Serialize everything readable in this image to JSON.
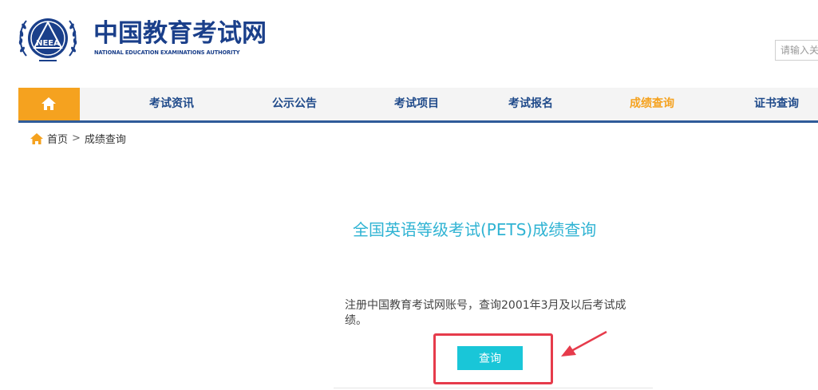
{
  "header": {
    "logo_title": "中国教育考试网",
    "logo_subtitle": "NATIONAL EDUCATION EXAMINATIONS AUTHORITY",
    "logo_emblem_text": "NEEA",
    "search_placeholder": "请输入关键字"
  },
  "nav": {
    "items": [
      {
        "label": "考试资讯"
      },
      {
        "label": "公示公告"
      },
      {
        "label": "考试项目"
      },
      {
        "label": "考试报名"
      },
      {
        "label": "成绩查询",
        "active": true
      },
      {
        "label": "证书查询"
      }
    ]
  },
  "breadcrumb": {
    "home": "首页",
    "separator": ">",
    "current": "成绩查询"
  },
  "main": {
    "title": "全国英语等级考试(PETS)成绩查询",
    "description": "注册中国教育考试网账号，查询2001年3月及以后考试成绩。",
    "query_button": "查询"
  },
  "colors": {
    "brand_blue": "#1a3f8a",
    "accent_orange": "#f5a21f",
    "title_cyan": "#2fb3d3",
    "button_cyan": "#19c6d8",
    "annotation_red": "#e63b4b"
  }
}
